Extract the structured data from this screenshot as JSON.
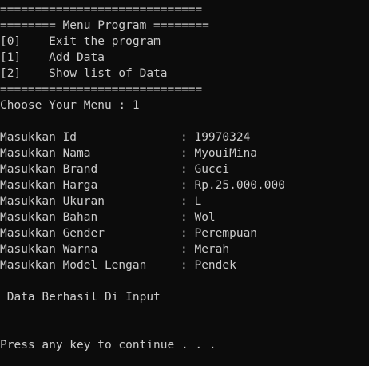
{
  "console": {
    "rule": "=============================",
    "menu_header": "======== Menu Program ========",
    "menu_items": [
      {
        "key": "[0]",
        "label": "Exit the program"
      },
      {
        "key": "[1]",
        "label": "Add Data"
      },
      {
        "key": "[2]",
        "label": "Show list of Data"
      }
    ],
    "prompt": "Choose Your Menu : 1",
    "fields": [
      {
        "label": "Masukkan Id",
        "value": "19970324"
      },
      {
        "label": "Masukkan Nama",
        "value": "MyouiMina"
      },
      {
        "label": "Masukkan Brand",
        "value": "Gucci"
      },
      {
        "label": "Masukkan Harga",
        "value": "Rp.25.000.000"
      },
      {
        "label": "Masukkan Ukuran",
        "value": "L"
      },
      {
        "label": "Masukkan Bahan",
        "value": "Wol"
      },
      {
        "label": "Masukkan Gender",
        "value": "Perempuan"
      },
      {
        "label": "Masukkan Warna",
        "value": "Merah"
      },
      {
        "label": "Masukkan Model Lengan",
        "value": "Pendek"
      }
    ],
    "separator": ":",
    "success_message": " Data Berhasil Di Input",
    "continue_prompt": "Press any key to continue . . ."
  }
}
